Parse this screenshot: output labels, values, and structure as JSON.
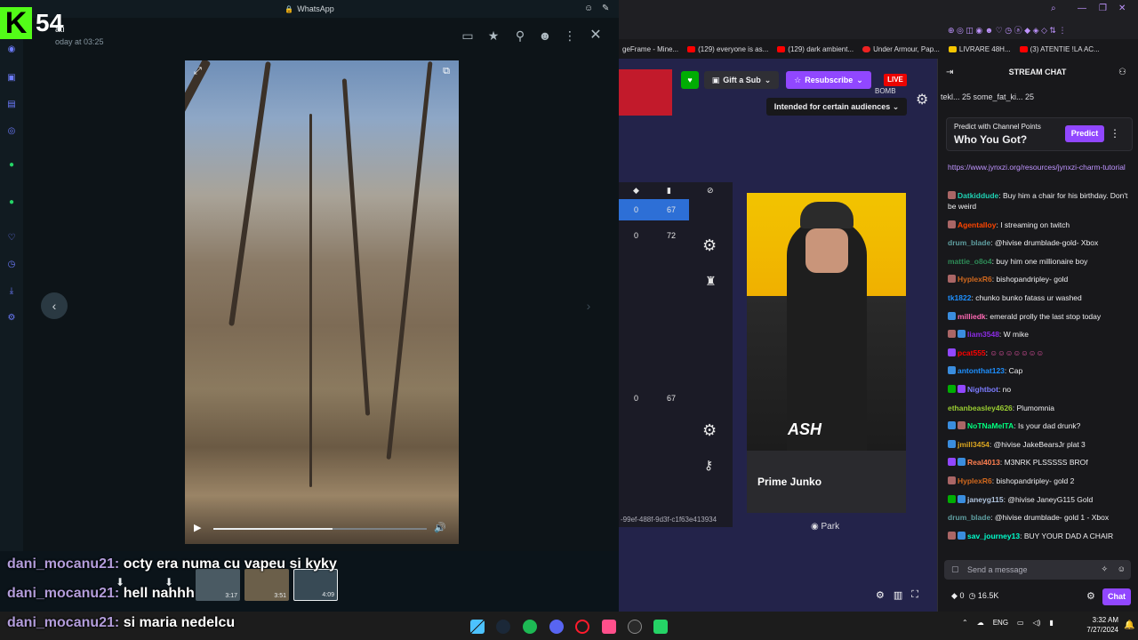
{
  "whatsapp": {
    "title": "WhatsApp",
    "sender": "ati",
    "timestamp": "oday at 03:25",
    "thumbs": [
      {
        "duration": "3:17"
      },
      {
        "duration": "3:51"
      },
      {
        "duration": "4:09"
      }
    ],
    "seek_progress": 0.56
  },
  "kick": {
    "viewer_count": "54"
  },
  "overlay_chat": [
    {
      "user": "dani_mocanu21:",
      "text": "octy era numa cu vapeu si kyky"
    },
    {
      "user": "dani_mocanu21:",
      "text": "hell nahhh"
    },
    {
      "user": "dani_mocanu21:",
      "text": "si maria nedelcu"
    }
  ],
  "bookmarks": [
    {
      "label": "geFrame - Mine..."
    },
    {
      "label": "(129) everyone is as..."
    },
    {
      "label": "(129) dark ambient..."
    },
    {
      "label": "Under Armour, Pap..."
    },
    {
      "label": "LIVRARE 48H..."
    },
    {
      "label": "(3) ATENTIE !LA AC..."
    }
  ],
  "twitch": {
    "gift_label": "Gift a Sub",
    "resub_label": "Resubscribe",
    "live_label": "LIVE",
    "bomb_label": "BOMB",
    "audience_label": "Intended for certain audiences",
    "operator_name": "Prime Junko",
    "operator_card_label": "ASH",
    "guid_text": "-99ef-488f-9d3f-c1f63e413934",
    "park_label": "Park",
    "stats": [
      {
        "a": "0",
        "b": "67"
      },
      {
        "a": "0",
        "b": "72"
      },
      {
        "a": "0",
        "b": "67"
      }
    ]
  },
  "chat": {
    "title": "STREAM CHAT",
    "leaderboard": "tekl... 25   some_fat_ki... 25",
    "predict_sub": "Predict with Channel Points",
    "predict_question": "Who You Got?",
    "predict_button": "Predict",
    "link_text": "https://www.jynxzi.org/resources/jynxzi-charm-tutorial",
    "messages": [
      {
        "user": "Datkiddude",
        "color": "#1fd1b3",
        "text": "Buy him a chair for his birthday. Don't be weird"
      },
      {
        "user": "Agentalloy",
        "color": "#ff4500",
        "text": "I streaming on twitch"
      },
      {
        "user": "drum_blade",
        "color": "#5f9ea0",
        "text": "@hivise drumblade-gold- Xbox"
      },
      {
        "user": "mattie_o8o4",
        "color": "#2e8b57",
        "text": "buy him one millionaire boy"
      },
      {
        "user": "HyplexR6",
        "color": "#d2691e",
        "text": "bishopandripley- gold"
      },
      {
        "user": "tk1822",
        "color": "#1e90ff",
        "text": "chunko bunko fatass ur washed"
      },
      {
        "user": "milliedk",
        "color": "#ff69b4",
        "text": "emerald prolly the last stop today"
      },
      {
        "user": "liam3548",
        "color": "#8a2be2",
        "text": "W mike"
      },
      {
        "user": "pcat555",
        "color": "#ff0000",
        "text": ""
      },
      {
        "user": "antonthat123",
        "color": "#1e90ff",
        "text": "Cap"
      },
      {
        "user": "Nightbot",
        "color": "#7c7cff",
        "text": "no"
      },
      {
        "user": "ethanbeasley4626",
        "color": "#9acd32",
        "text": "Plumomnia"
      },
      {
        "user": "NoTNaMeITA",
        "color": "#00ff7f",
        "text": "Is your dad drunk?"
      },
      {
        "user": "jmill3454",
        "color": "#daa520",
        "text": "@hivise JakeBearsJr plat 3"
      },
      {
        "user": "Real4013",
        "color": "#ff7f50",
        "text": "M3NRK PLSSSSS BROf"
      },
      {
        "user": "HyplexR6",
        "color": "#d2691e",
        "text": "bishopandripley- gold 2"
      },
      {
        "user": "janeyg115",
        "color": "#b0c4de",
        "text": "@hivise JaneyG115 Gold"
      },
      {
        "user": "drum_blade",
        "color": "#5f9ea0",
        "text": "@hivise drumblade- gold 1 - Xbox"
      },
      {
        "user": "sav_journey13",
        "color": "#00ffcc",
        "text": "BUY YOUR DAD A CHAIR"
      }
    ],
    "send_placeholder": "Send a message",
    "points": "0",
    "viewers": "16.5K",
    "chat_button": "Chat"
  },
  "taskbar": {
    "lang": "ENG",
    "time": "3:32 AM",
    "date": "7/27/2024"
  },
  "colors": {
    "twitch_purple": "#9147ff",
    "live_red": "#eb0400",
    "kick_green": "#53fc18",
    "whatsapp_bg": "#0b141a"
  }
}
